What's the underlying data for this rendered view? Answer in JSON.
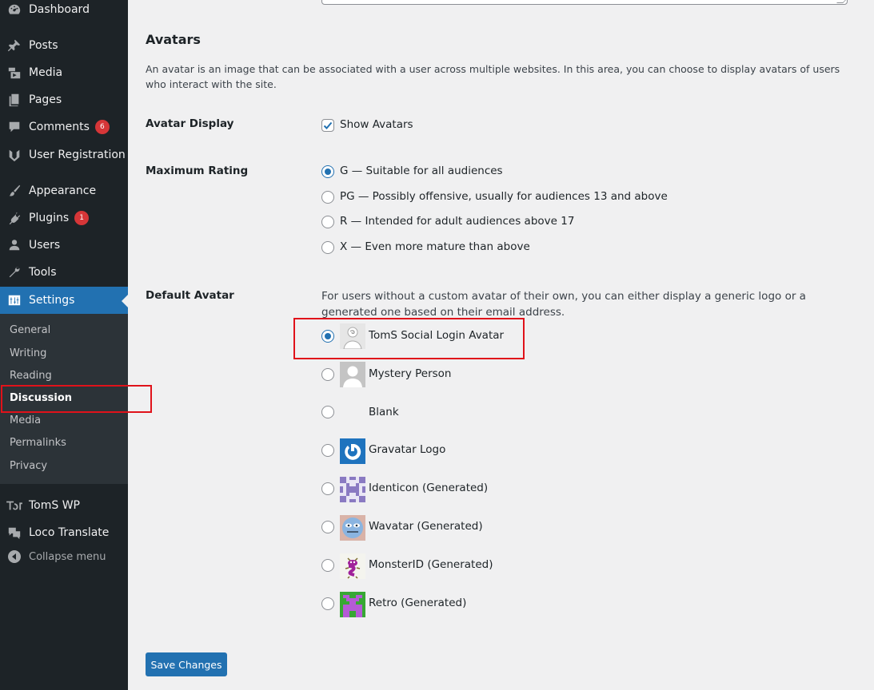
{
  "sidebar": {
    "items": [
      {
        "label": "Dashboard",
        "icon": "dashboard-icon"
      },
      {
        "label": "Posts",
        "icon": "pin-icon"
      },
      {
        "label": "Media",
        "icon": "media-icon"
      },
      {
        "label": "Pages",
        "icon": "pages-icon"
      },
      {
        "label": "Comments",
        "icon": "comments-icon",
        "badge": "6"
      },
      {
        "label": "User Registration",
        "icon": "user-registration-icon"
      },
      {
        "label": "Appearance",
        "icon": "brush-icon"
      },
      {
        "label": "Plugins",
        "icon": "plugin-icon",
        "badge": "1"
      },
      {
        "label": "Users",
        "icon": "users-icon"
      },
      {
        "label": "Tools",
        "icon": "wrench-icon"
      },
      {
        "label": "Settings",
        "icon": "settings-icon"
      },
      {
        "label": "TomS WP",
        "icon": "toms-logo-icon"
      },
      {
        "label": "Loco Translate",
        "icon": "loco-icon"
      }
    ],
    "submenu": [
      "General",
      "Writing",
      "Reading",
      "Discussion",
      "Media",
      "Permalinks",
      "Privacy"
    ],
    "current_submenu": "Discussion",
    "collapse_label": "Collapse menu"
  },
  "main": {
    "section_title": "Avatars",
    "description": "An avatar is an image that can be associated with a user across multiple websites. In this area, you can choose to display avatars of users who interact with the site.",
    "avatar_display": {
      "label": "Avatar Display",
      "checkbox_label": "Show Avatars",
      "checked": true
    },
    "maximum_rating": {
      "label": "Maximum Rating",
      "options": [
        {
          "label": "G — Suitable for all audiences",
          "checked": true
        },
        {
          "label": "PG — Possibly offensive, usually for audiences 13 and above",
          "checked": false
        },
        {
          "label": "R — Intended for adult audiences above 17",
          "checked": false
        },
        {
          "label": "X — Even more mature than above",
          "checked": false
        }
      ]
    },
    "default_avatar": {
      "label": "Default Avatar",
      "description": "For users without a custom avatar of their own, you can either display a generic logo or a generated one based on their email address.",
      "options": [
        {
          "label": "TomS Social Login Avatar",
          "checked": true,
          "icon": "toms-social-avatar-icon"
        },
        {
          "label": "Mystery Person",
          "checked": false,
          "icon": "mystery-person-icon"
        },
        {
          "label": "Blank",
          "checked": false,
          "icon": "blank-avatar"
        },
        {
          "label": "Gravatar Logo",
          "checked": false,
          "icon": "gravatar-logo-icon"
        },
        {
          "label": "Identicon (Generated)",
          "checked": false,
          "icon": "identicon-icon"
        },
        {
          "label": "Wavatar (Generated)",
          "checked": false,
          "icon": "wavatar-icon"
        },
        {
          "label": "MonsterID (Generated)",
          "checked": false,
          "icon": "monsterid-icon"
        },
        {
          "label": "Retro (Generated)",
          "checked": false,
          "icon": "retro-icon"
        }
      ]
    },
    "save_label": "Save Changes"
  },
  "colors": {
    "sidebar_bg": "#1d2327",
    "submenu_bg": "#2c3338",
    "accent": "#2271b1",
    "badge": "#d63638",
    "highlight_box": "#e0121a"
  }
}
